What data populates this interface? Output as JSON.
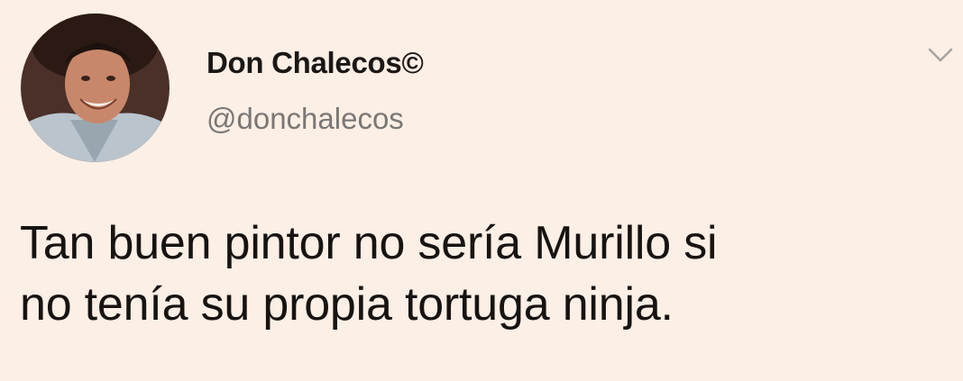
{
  "tweet": {
    "author": {
      "display_name": "Don Chalecos©",
      "handle": "@donchalecos",
      "avatar_icon": "profile-photo"
    },
    "menu_icon": "chevron-down-icon",
    "text_lines": [
      "Tan buen pintor no sería Murillo si",
      "no tenía su propia tortuga ninja."
    ]
  },
  "colors": {
    "background": "#fbefe6",
    "name": "#1b1715",
    "handle": "#7b7774",
    "text": "#171311",
    "chevron": "#a8a4a1"
  }
}
